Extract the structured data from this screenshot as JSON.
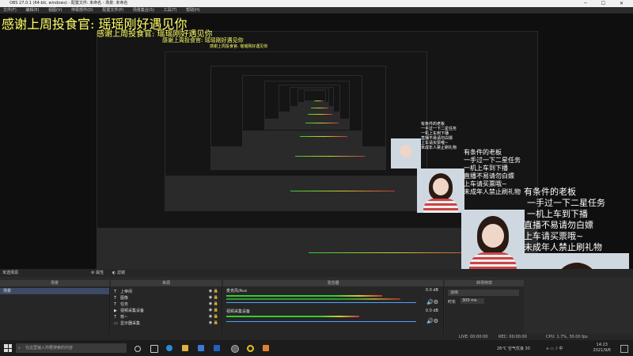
{
  "window": {
    "title": "OBS 27.0.1 (64-bit, windows) - 配置文件: 未命名 - 场景: 未命名"
  },
  "menu": [
    "文件(F)",
    "编辑(E)",
    "视图(V)",
    "停靠部件(D)",
    "配置文件(P)",
    "场景集合(S)",
    "工具(T)",
    "帮助(H)"
  ],
  "overlay": {
    "gift_text": "感谢上周投食官: 瑶瑶刚好遇见你",
    "danmu": [
      "有条件的老板",
      "一手过一下二星任务",
      "一机上车到下播",
      "直播不易请勿白嫖",
      "上车请买票哦~",
      "未成年人禁止刷礼物"
    ]
  },
  "dock": {
    "no_source_label": "未选择源",
    "properties_label": "属性",
    "filters_label": "滤镜",
    "scenes_header": "场景",
    "sources_header": "来源",
    "mixer_header": "混音器",
    "transitions_header": "转场特效",
    "scenes": [
      "场景"
    ],
    "sources": [
      {
        "name": "上帝闲",
        "icon": "T"
      },
      {
        "name": "图像",
        "icon": "T"
      },
      {
        "name": "任务",
        "icon": "T"
      },
      {
        "name": "视频采集设备",
        "icon": "▶"
      },
      {
        "name": "核~",
        "icon": "T"
      },
      {
        "name": "显示器采集",
        "icon": "▭"
      }
    ],
    "mixer": [
      {
        "name": "麦克风/Aux",
        "db": "0.0 dB",
        "level": 0.82
      },
      {
        "name": "视频采集设备",
        "db": "0.0 dB",
        "level": 0.7
      }
    ],
    "transition": {
      "type": "淡出",
      "duration_label": "时长",
      "duration": "300 ms"
    }
  },
  "status": {
    "live": "LIVE: 00:00:00",
    "rec": "REC: 00:00:00",
    "cpu": "CPU: 1.7%, 30.00 fps"
  },
  "taskbar": {
    "search_placeholder": "在这里输入你要搜索的内容",
    "weather": "26°C 空气优良 30",
    "time": "14:23",
    "date": "2021/9/6"
  }
}
